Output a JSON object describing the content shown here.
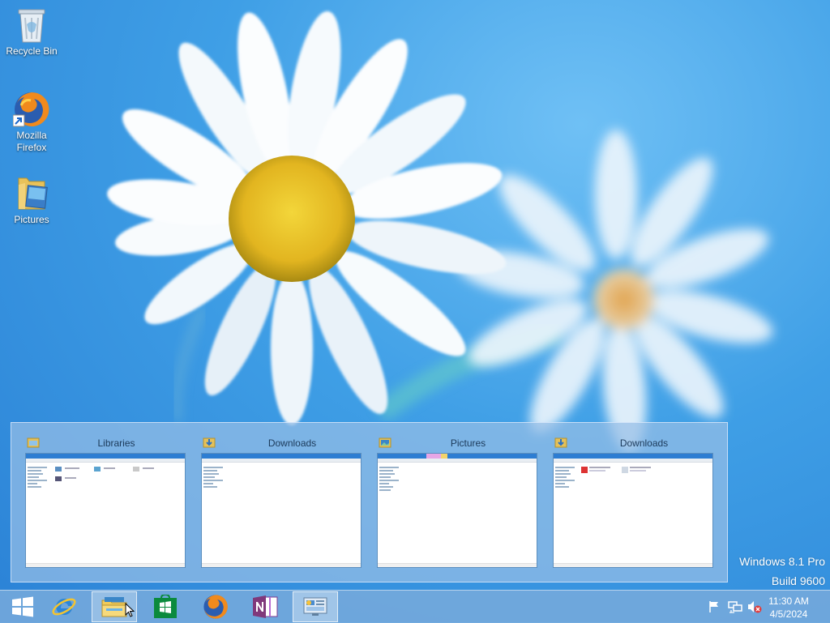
{
  "desktop": {
    "icons": [
      {
        "label": "Recycle Bin",
        "icon": "recycle-bin-icon"
      },
      {
        "label_line1": "Mozilla",
        "label_line2": "Firefox",
        "icon": "firefox-icon"
      },
      {
        "label": "Pictures",
        "icon": "folder-icon"
      }
    ],
    "watermark": {
      "line1": "Windows 8.1 Pro",
      "line2": "Build 9600"
    }
  },
  "thumbnails": [
    {
      "title": "Libraries"
    },
    {
      "title": "Downloads"
    },
    {
      "title": "Pictures"
    },
    {
      "title": "Downloads"
    }
  ],
  "taskbar": {
    "buttons": [
      "start-icon",
      "internet-explorer-icon",
      "file-explorer-icon",
      "store-icon",
      "firefox-icon",
      "onenote-icon",
      "control-panel-icon"
    ],
    "tray": [
      "action-center-flag-icon",
      "network-icon",
      "volume-muted-icon"
    ],
    "clock": {
      "time": "11:30 AM",
      "date": "4/5/2024"
    }
  },
  "colors": {
    "taskbar": "#78aadc",
    "accent": "#2d7dd2"
  }
}
